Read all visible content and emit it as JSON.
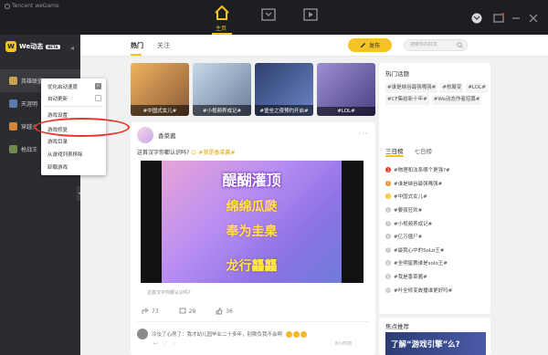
{
  "app": {
    "brand": "Tencent weGame"
  },
  "topnav": {
    "home_label": "主页",
    "colors": {
      "accent": "#f5c324",
      "bg": "#1d1e22"
    }
  },
  "sidebar": {
    "logo_text": "We动态",
    "logo_badge": "BETA",
    "games": [
      {
        "label": "英雄联盟",
        "icon_color": "#c8a253"
      },
      {
        "label": "天涯明",
        "icon_color": "#5a7bb0"
      },
      {
        "label": "穿越火",
        "icon_color": "#d2873a"
      },
      {
        "label": "枪战王",
        "icon_color": "#6e8a4c"
      }
    ]
  },
  "context_menu": {
    "items": [
      {
        "label": "优化启动速度",
        "checked": true
      },
      {
        "label": "自动更新",
        "checked": false
      },
      {
        "label": "游戏设置"
      },
      {
        "label": "游戏修复"
      },
      {
        "label": "游戏目录"
      },
      {
        "label": "从游戏列表移除"
      },
      {
        "label": "卸载游戏"
      }
    ]
  },
  "main": {
    "tabs": {
      "hot": "热门",
      "follow": "关注"
    },
    "post_button": "发布",
    "search_placeholder": "搜索你的好友",
    "banners": [
      {
        "caption": "#中国式女儿#",
        "c1": "#f0b35c",
        "c2": "#8a5a3a"
      },
      {
        "caption": "#小视频养成记#",
        "c1": "#c7d8e9",
        "c2": "#6a7e9a"
      },
      {
        "caption": "#堡垒之夜预约开启#",
        "c1": "#2c3f6e",
        "c2": "#6b84c4"
      },
      {
        "caption": "#LOL#",
        "c1": "#9d8fd1",
        "c2": "#4b3e84"
      }
    ],
    "post": {
      "author": "香菜酱",
      "text": "这首汉字你都认识吗?",
      "tag": "#我是香菜酱#",
      "video_lines": [
        "醍醐灌顶",
        "绵绵瓜瓞",
        "奉为圭臬",
        "龙行龘龘"
      ],
      "video_caption": "这首汉字你都认识吗?",
      "likes": "36",
      "comments": "28",
      "shares": "73",
      "comment": "冷淡了心房了：我才幼儿园毕业二十多年，别欺负我不会啊",
      "comment_time": "8小时前"
    }
  },
  "right": {
    "hot_topics_title": "热门话题",
    "topics": [
      "#谁是峡谷最强嘴强#",
      "#核聚变",
      "#LOL#",
      "#CF集结新十年#",
      "#We动态作者招募#"
    ],
    "rank_tabs": [
      "三日榜",
      "七日榜"
    ],
    "ranks": [
      {
        "n": "1",
        "text": "#物理和法系哪个更强?#",
        "color": "#e8332c"
      },
      {
        "n": "2",
        "text": "#谁是峡谷最强嘴强#",
        "color": "#f08a2c"
      },
      {
        "n": "3",
        "text": "#中国式女儿#",
        "color": "#f5c324"
      },
      {
        "n": "4",
        "text": "#要夜狂欢#",
        "color": "#c7c7c7"
      },
      {
        "n": "5",
        "text": "#小视频养成记#",
        "color": "#c7c7c7"
      },
      {
        "n": "6",
        "text": "#亿万僵尸#",
        "color": "#c7c7c7"
      },
      {
        "n": "7",
        "text": "#最我心中的SoLo王#",
        "color": "#c7c7c7"
      },
      {
        "n": "8",
        "text": "#全明星赛谁是solo王#",
        "color": "#c7c7c7"
      },
      {
        "n": "9",
        "text": "#我是香菜酱#",
        "color": "#c7c7c7"
      },
      {
        "n": "10",
        "text": "#叶全修变故播谁更好吗#",
        "color": "#c7c7c7"
      }
    ],
    "focus_title": "焦点推荐",
    "focus_banner": "了解“游戏引擎”么?"
  }
}
